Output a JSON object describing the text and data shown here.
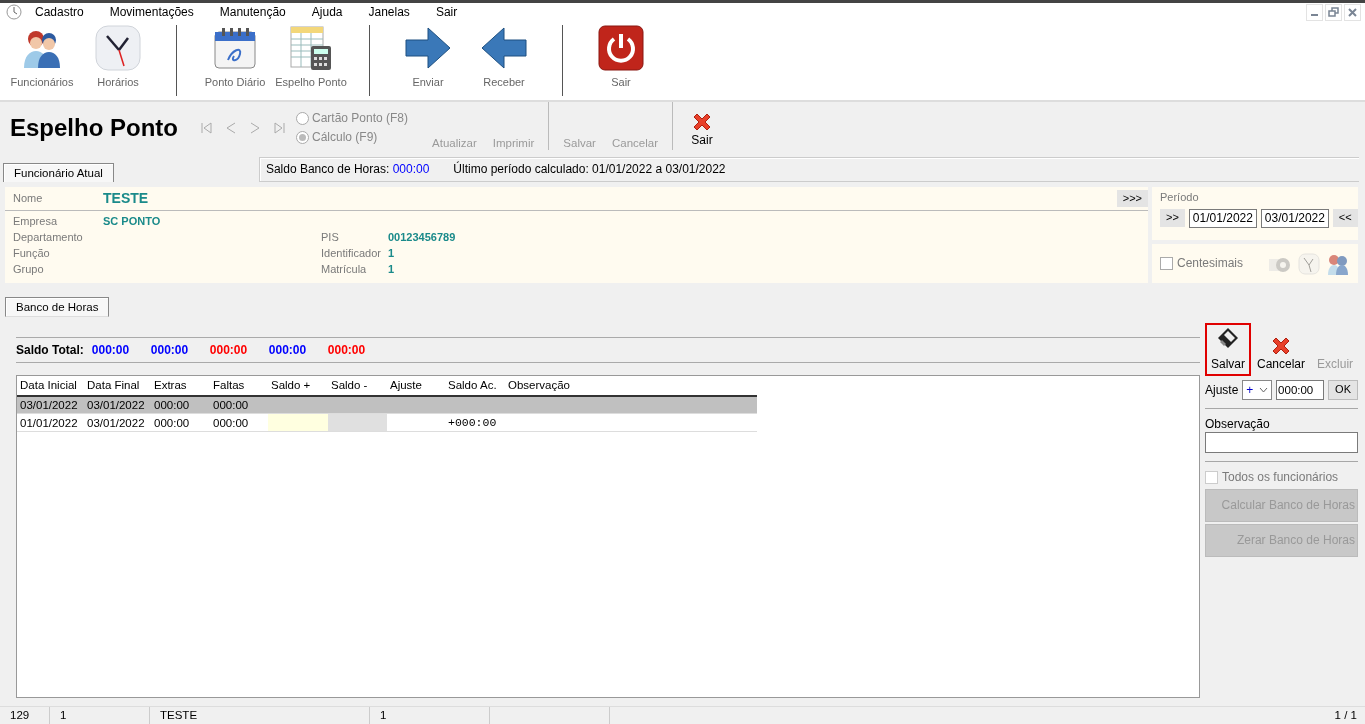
{
  "menu": {
    "items": [
      "Cadastro",
      "Movimentações",
      "Manutenção",
      "Ajuda",
      "Janelas",
      "Sair"
    ]
  },
  "toolbar": {
    "groups": [
      [
        {
          "label": "Funcionários",
          "kind": "people"
        },
        {
          "label": "Horários",
          "kind": "clock"
        }
      ],
      [
        {
          "label": "Ponto Diário",
          "kind": "calendar"
        },
        {
          "label": "Espelho Ponto",
          "kind": "sheet"
        }
      ],
      [
        {
          "label": "Enviar",
          "kind": "forward"
        },
        {
          "label": "Receber",
          "kind": "back"
        }
      ],
      [
        {
          "label": "Sair",
          "kind": "power"
        }
      ]
    ]
  },
  "form": {
    "title": "Espelho Ponto",
    "modes": [
      {
        "label": "Cartão Ponto (F8)",
        "selected": false
      },
      {
        "label": "Cálculo (F9)",
        "selected": true
      }
    ],
    "actions": [
      {
        "label": "Atualizar",
        "disabled": true
      },
      {
        "label": "Imprimir",
        "disabled": true
      },
      {
        "label": "Salvar",
        "disabled": true
      },
      {
        "label": "Cancelar",
        "disabled": true
      }
    ],
    "exit": "Sair"
  },
  "employee_tab": {
    "label": "Funcionário Atual",
    "selected": true
  },
  "info": {
    "balance_label": "Saldo Banco de Horas:",
    "balance": "000:00",
    "period_text": "Último período calculado: 01/01/2022 a 03/01/2022"
  },
  "employee": {
    "name_label": "Nome",
    "name": "TESTE",
    "more": ">>>",
    "rows": [
      {
        "label": "Empresa",
        "value": "SC PONTO"
      },
      {
        "label": "Departamento",
        "right_label": "PIS",
        "right_value": "00123456789"
      },
      {
        "label": "Função",
        "right_label": "Identificador",
        "right_value": "1"
      },
      {
        "label": "Grupo",
        "right_label": "Matrícula",
        "right_value": "1"
      }
    ]
  },
  "period": {
    "label": "Período",
    "prev": ">>",
    "from": "01/01/2022",
    "to": "03/01/2022",
    "next": "<<"
  },
  "centesimais": {
    "label": "Centesimais",
    "checked": false
  },
  "section_tab": {
    "label": "Banco de Horas",
    "selected": true
  },
  "totals": {
    "label": "Saldo Total:",
    "values": [
      {
        "text": "000:00",
        "color": "#0000ff"
      },
      {
        "text": "000:00",
        "color": "#0000ff"
      },
      {
        "text": "000:00",
        "color": "#ff0000"
      },
      {
        "text": "000:00",
        "color": "#0000ff"
      },
      {
        "text": "000:00",
        "color": "#ff0000"
      }
    ]
  },
  "table": {
    "columns": [
      "Data Inicial",
      "Data Final",
      "Extras",
      "Faltas",
      "Saldo +",
      "Saldo -",
      "Ajuste",
      "Saldo Ac.",
      "Observação"
    ],
    "rows": [
      {
        "selected": true,
        "cells": [
          "03/01/2022",
          "03/01/2022",
          "000:00",
          "000:00",
          null,
          null,
          null,
          null,
          null
        ]
      },
      {
        "selected": false,
        "cells": [
          "01/01/2022",
          "03/01/2022",
          "000:00",
          "000:00",
          {
            "color": "#ffffe0"
          },
          {
            "color": "#e0e0e0"
          },
          null,
          "+000:00",
          null
        ]
      }
    ]
  },
  "side": {
    "actions": [
      {
        "label": "Salvar",
        "kind": "save",
        "disabled": false,
        "focused": true
      },
      {
        "label": "Cancelar",
        "kind": "cancel",
        "disabled": false,
        "focused": false
      },
      {
        "label": "Excluir",
        "kind": "delete",
        "disabled": true,
        "focused": false
      }
    ],
    "adjust_label": "Ajuste",
    "sign": "+",
    "time": "000:00",
    "ok": "OK",
    "obs_label": "Observação",
    "all_label": "Todos os funcionários",
    "all_checked": false,
    "buttons": [
      {
        "label": "Calcular Banco de Horas",
        "disabled": true
      },
      {
        "label": "Zerar Banco de Horas",
        "disabled": true
      }
    ]
  },
  "status_bar": [
    "129",
    "1",
    "TESTE",
    "1",
    "1 / 1"
  ]
}
